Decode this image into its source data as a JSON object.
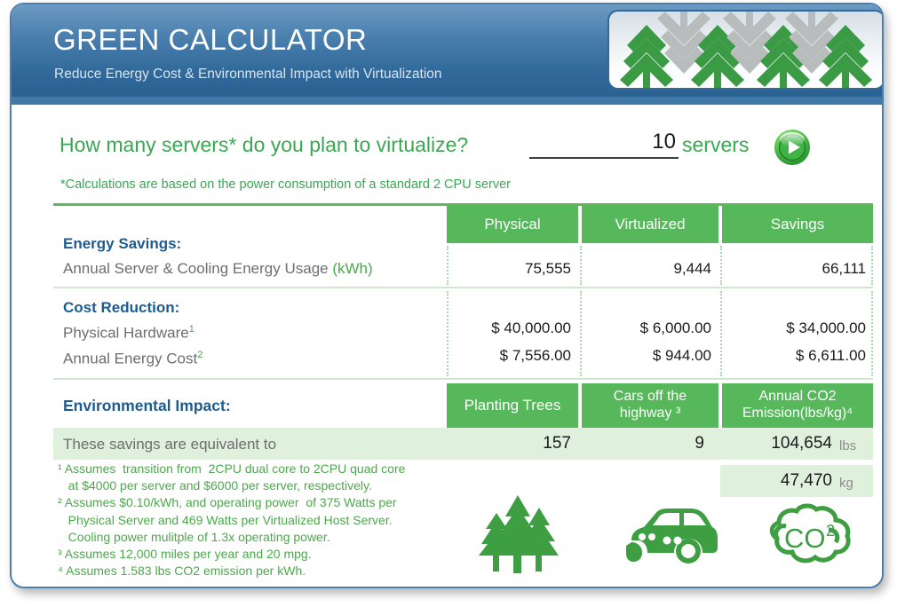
{
  "header": {
    "title": "GREEN CALCULATOR",
    "subtitle": "Reduce Energy Cost & Environmental Impact with Virtualization",
    "logo_icon": "trees-arrows-logo"
  },
  "question": {
    "text": "How many servers* do you plan to virtualize?",
    "value": "10",
    "unit_label": "servers",
    "go_icon": "play-button-icon",
    "note": "*Calculations are based on the power consumption of a standard 2 CPU server"
  },
  "table": {
    "columns": [
      "Physical",
      "Virtualized",
      "Savings"
    ],
    "sections": [
      {
        "title": "Energy Savings:",
        "rows": [
          {
            "label": "Annual Server & Cooling Energy Usage ",
            "label_green": "(kWh)",
            "values": [
              "75,555",
              "9,444",
              "66,111"
            ]
          }
        ]
      },
      {
        "title": "Cost Reduction:",
        "rows": [
          {
            "label": "Physical Hardware",
            "sup": "1",
            "values": [
              "$ 40,000.00",
              "$ 6,000.00",
              "$ 34,000.00"
            ]
          },
          {
            "label": "Annual Energy Cost",
            "sup": "2",
            "values": [
              "$ 7,556.00",
              "$ 944.00",
              "$ 6,611.00"
            ]
          }
        ]
      }
    ]
  },
  "environmental": {
    "title": "Environmental Impact:",
    "columns": [
      {
        "line1": "Planting Trees",
        "line2": ""
      },
      {
        "line1": "Cars off the",
        "line2": "highway ³"
      },
      {
        "line1": "Annual CO2",
        "line2": "Emission(lbs/kg)⁴"
      }
    ],
    "equivalent_label": "These savings are equivalent to",
    "values": [
      "157",
      "9",
      "104,654"
    ],
    "co2_unit_lbs": "lbs",
    "co2_kg_value": "47,470",
    "co2_unit_kg": "kg"
  },
  "footnotes": [
    "¹ Assumes  transition from  2CPU dual core to 2CPU quad core",
    "   at $4000 per server and $6000 per server, respectively.",
    "² Assumes $0.10/kWh, and operating power  of 375 Watts per",
    "   Physical Server and 469 Watts per Virtualized Host Server.",
    "   Cooling power mulitple of 1.3x operating power.",
    "³ Assumes 12,000 miles per year and 20 mpg.",
    "⁴ Assumes 1.583 lbs CO2 emission per kWh."
  ],
  "icons": {
    "trees": "trees-icon",
    "car": "car-icon",
    "co2": "co2-cloud-icon"
  },
  "colors": {
    "header_blue": "#2f6899",
    "accent_green": "#56b75b",
    "label_blue": "#1d5c91",
    "light_green_row": "#dff0dc"
  }
}
